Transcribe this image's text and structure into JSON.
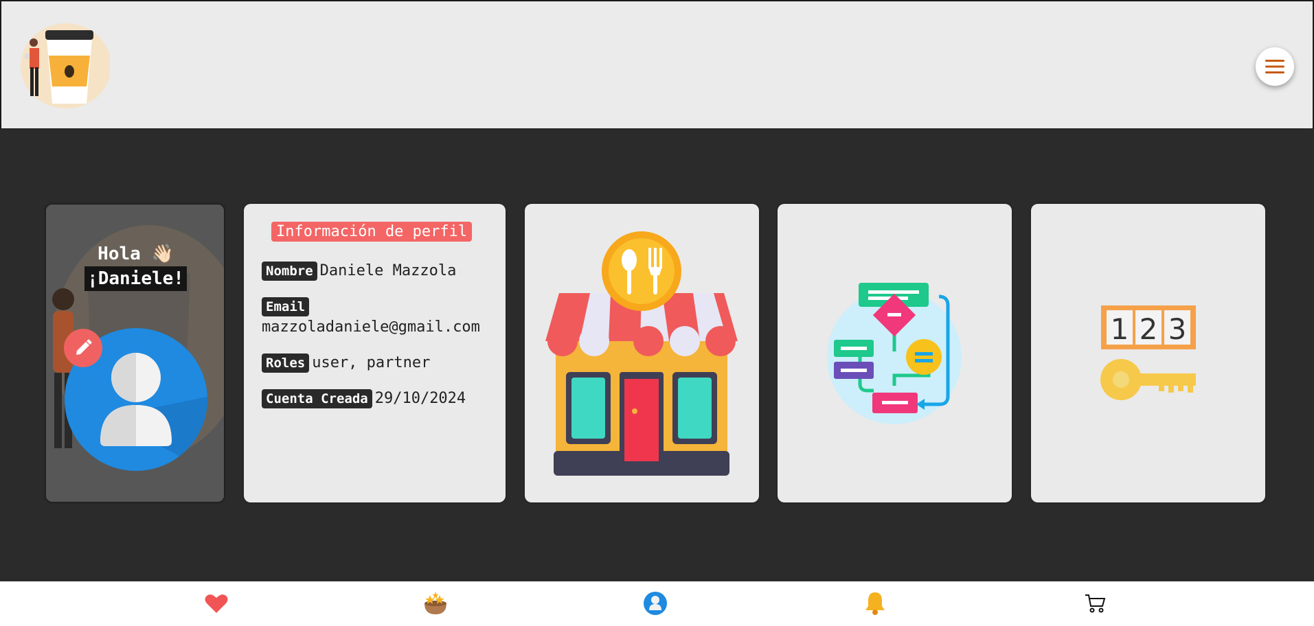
{
  "header": {
    "logo_icon": "coffee-cup-person-logo",
    "menu_icon": "hamburger-menu-icon",
    "accent_color": "#c55a11"
  },
  "greeting": {
    "line1": "Hola 👋🏻",
    "line2": "¡Daniele!"
  },
  "profile": {
    "title": "Información de perfil",
    "fields": [
      {
        "label": "Nombre",
        "value": "Daniele Mazzola"
      },
      {
        "label": "Email",
        "value": "mazzoladaniele@gmail.com"
      },
      {
        "label": "Roles",
        "value": "user, partner"
      },
      {
        "label": "Cuenta Creada",
        "value": "29/10/2024"
      }
    ]
  },
  "cards": [
    {
      "icon": "restaurant-store-icon"
    },
    {
      "icon": "flowchart-icon"
    },
    {
      "icon": "password-key-icon"
    }
  ],
  "bottom_nav": [
    {
      "icon": "heart-icon",
      "color": "#f05454"
    },
    {
      "icon": "rating-basket-icon"
    },
    {
      "icon": "profile-icon",
      "color": "#1f8ae0"
    },
    {
      "icon": "bell-icon",
      "color": "#f5b220"
    },
    {
      "icon": "cart-icon"
    }
  ],
  "colors": {
    "header_bg": "#ebebeb",
    "page_bg": "#2b2b2b",
    "card_bg": "#eaeaea",
    "title_badge": "#f46565",
    "label_bg": "#2a2a2a"
  }
}
